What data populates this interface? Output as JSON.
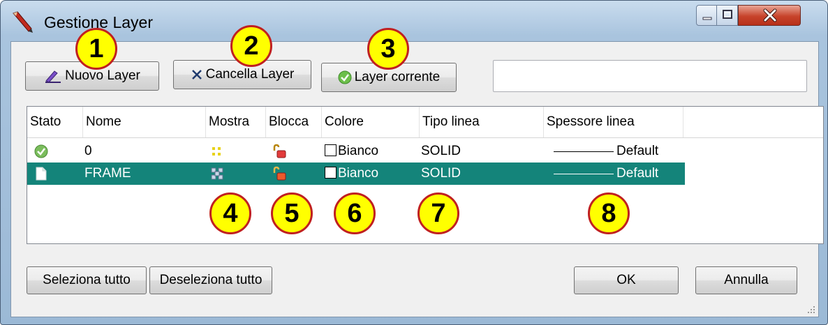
{
  "window": {
    "title": "Gestione Layer",
    "accent_color": "#14847a",
    "close_color": "#c7432b"
  },
  "toolbar": {
    "new_layer_label": "Nuovo Layer",
    "delete_layer_label": "Cancella Layer",
    "current_layer_label": "Layer corrente",
    "search_value": ""
  },
  "table": {
    "columns": [
      "Stato",
      "Nome",
      "Mostra",
      "Blocca",
      "Colore",
      "Tipo linea",
      "Spessore linea"
    ],
    "rows": [
      {
        "status_icon": "check-icon",
        "name": "0",
        "visible_icon": "lightbulb-on-icon",
        "lock_icon": "padlock-open-icon",
        "color": "Bianco",
        "linetype": "SOLID",
        "lineweight": "Default",
        "selected": false
      },
      {
        "status_icon": "page-icon",
        "name": "FRAME",
        "visible_icon": "lightbulb-off-icon",
        "lock_icon": "padlock-open-icon",
        "color": "Bianco",
        "linetype": "SOLID",
        "lineweight": "Default",
        "selected": true
      }
    ]
  },
  "callouts": [
    "1",
    "2",
    "3",
    "4",
    "5",
    "6",
    "7",
    "8"
  ],
  "footer": {
    "select_all_label": "Seleziona tutto",
    "deselect_all_label": "Deseleziona tutto",
    "ok_label": "OK",
    "cancel_label": "Annulla"
  }
}
